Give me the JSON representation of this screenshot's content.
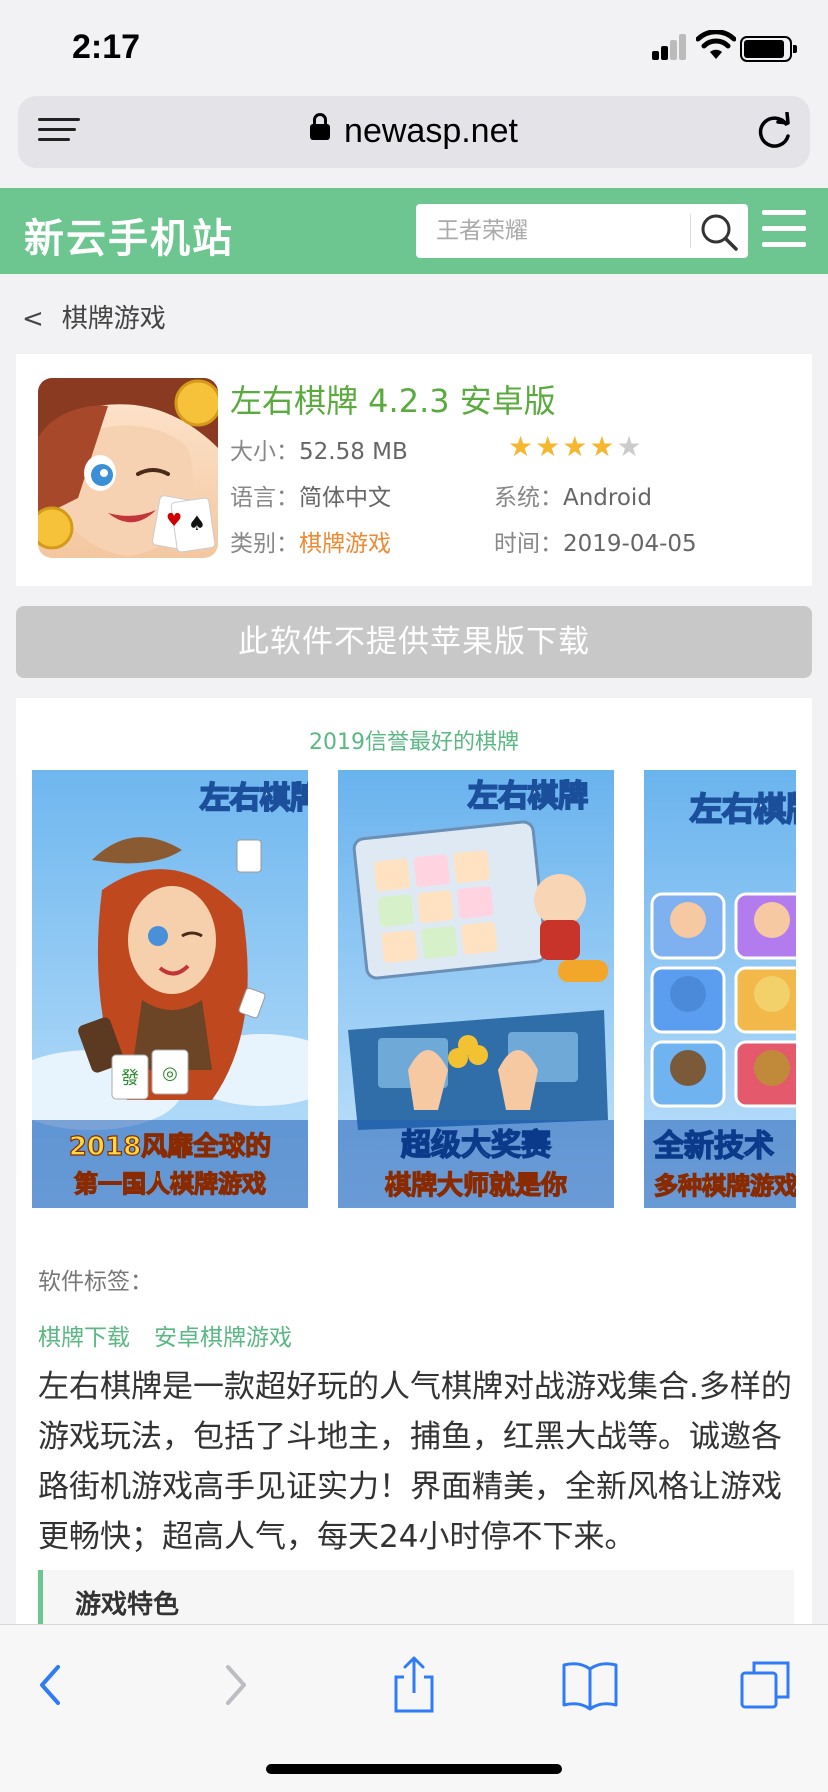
{
  "status": {
    "time": "2:17"
  },
  "browser": {
    "url": "newasp.net"
  },
  "site": {
    "logo": "新云手机站",
    "search_placeholder": "王者荣耀"
  },
  "breadcrumb": {
    "back_symbol": "<",
    "label": "棋牌游戏"
  },
  "app": {
    "title": "左右棋牌 4.2.3 安卓版",
    "size_label": "大小：",
    "size": "52.58 MB",
    "rating": 4,
    "rating_max": 5,
    "language_label": "语言：",
    "language": "简体中文",
    "system_label": "系统：",
    "system": "Android",
    "category_label": "类别：",
    "category": "棋牌游戏",
    "time_label": "时间：",
    "time": "2019-04-05"
  },
  "download": {
    "no_ios_label": "此软件不提供苹果版下载"
  },
  "screenshots": {
    "title": "2019信誉最好的棋牌",
    "shots": [
      {
        "brand": "左右棋牌",
        "line1": "2018风靡全球的",
        "line2": "第一国人棋牌游戏"
      },
      {
        "brand": "左右棋牌",
        "line1": "超级大奖赛",
        "line2": "棋牌大师就是你"
      },
      {
        "brand": "左右棋牌",
        "line1": "全新技术",
        "line2": "多种棋牌游戏"
      }
    ]
  },
  "tags": {
    "label": "软件标签：",
    "items": [
      "棋牌下载",
      "安卓棋牌游戏"
    ]
  },
  "description": "左右棋牌是一款超好玩的人气棋牌对战游戏集合.多样的游戏玩法，包括了斗地主，捕鱼，红黑大战等。诚邀各路街机游戏高手见证实力！界面精美，全新风格让游戏更畅快；超高人气，每天24小时停不下来。",
  "features": {
    "title": "游戏特色"
  },
  "colors": {
    "brand_green": "#6dc690",
    "title_green": "#5aab3e",
    "link_green": "#5ab883",
    "category_orange": "#ee8a33",
    "star_gold": "#f5b730",
    "ios_blue": "#2f7cf6"
  },
  "icons": {
    "menu": "hamburger-icon",
    "search": "search-icon",
    "reload": "reload-icon",
    "lock": "lock-icon",
    "back": "chevron-left-icon",
    "forward": "chevron-right-icon",
    "share": "share-icon",
    "bookmarks": "book-icon",
    "tabs": "tabs-icon"
  }
}
